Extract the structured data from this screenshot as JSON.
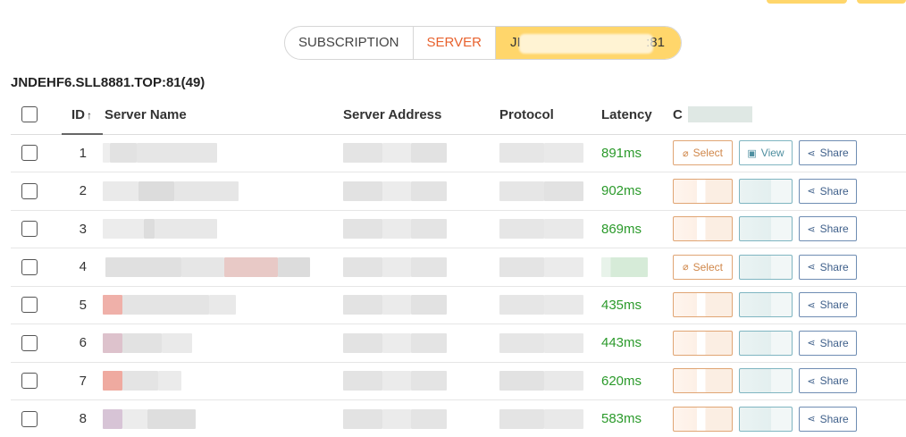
{
  "tabs": [
    {
      "label": "SUBSCRIPTION"
    },
    {
      "label": "SERVER"
    },
    {
      "label_prefix": "JI",
      "label_suffix": ":81"
    }
  ],
  "group_title": "JNDEHF6.SLL8881.TOP:81(49)",
  "columns": {
    "id": "ID",
    "sort_arrow": "↑",
    "name": "Server Name",
    "address": "Server Address",
    "protocol": "Protocol",
    "latency": "Latency",
    "ops_prefix": "C"
  },
  "buttons": {
    "select": "Select",
    "view": "View",
    "share": "Share"
  },
  "icons": {
    "select": "link-icon",
    "view": "qr-icon",
    "share": "share-icon"
  },
  "colors": {
    "accent_yellow": "#ffd66b",
    "server_tab": "#e8622e",
    "latency_green": "#2b9a2b"
  },
  "rows": [
    {
      "id": "1",
      "latency": "891ms",
      "name_blocks": [
        "#eeeeee",
        "#e2e2e2",
        "#e6e6e6"
      ],
      "addr_blocks": [
        "#e4e4e4",
        "#ececec",
        "#e2e2e2"
      ],
      "proto_blocks": [
        "#e6e6e6",
        "#e9e9e9"
      ],
      "select_masked": false,
      "view_masked": false,
      "latency_masked": false
    },
    {
      "id": "2",
      "latency": "902ms",
      "name_blocks": [
        "#eaeaea",
        "#dcdcdc",
        "#e6e6e6"
      ],
      "addr_blocks": [
        "#e2e2e2",
        "#ececec",
        "#e3e3e3"
      ],
      "proto_blocks": [
        "#e6e6e6",
        "#e2e2e2"
      ],
      "select_masked": true,
      "view_masked": true,
      "latency_masked": false
    },
    {
      "id": "3",
      "latency": "869ms",
      "name_blocks": [
        "#ececec",
        "#dddddd",
        "#e8e8e8"
      ],
      "addr_blocks": [
        "#e3e3e3",
        "#ebebeb",
        "#e4e4e4"
      ],
      "proto_blocks": [
        "#e6e6e6",
        "#e9e9e9"
      ],
      "select_masked": true,
      "view_masked": true,
      "latency_masked": false
    },
    {
      "id": "4",
      "latency": "",
      "name_blocks": [
        "#e0e0e0",
        "#e6e6e6",
        "#e8c9c6",
        "#dcdcdc"
      ],
      "addr_blocks": [
        "#e3e3e3",
        "#ebebeb",
        "#e4e4e4"
      ],
      "proto_blocks": [
        "#e4e4e4",
        "#ebebeb"
      ],
      "select_masked": false,
      "view_masked": true,
      "latency_masked": true
    },
    {
      "id": "5",
      "latency": "435ms",
      "name_blocks": [
        "#efb0a9",
        "#e4e4e4",
        "#e9e9e9"
      ],
      "addr_blocks": [
        "#e3e3e3",
        "#ebebeb",
        "#e2e2e2"
      ],
      "proto_blocks": [
        "#e6e6e6",
        "#e9e9e9"
      ],
      "select_masked": true,
      "view_masked": true,
      "latency_masked": false
    },
    {
      "id": "6",
      "latency": "443ms",
      "name_blocks": [
        "#ddc2cc",
        "#e2e2e2",
        "#eaeaea"
      ],
      "addr_blocks": [
        "#e3e3e3",
        "#ececec",
        "#e4e4e4"
      ],
      "proto_blocks": [
        "#e6e6e6",
        "#e9e9e9"
      ],
      "select_masked": true,
      "view_masked": true,
      "latency_masked": false
    },
    {
      "id": "7",
      "latency": "620ms",
      "name_blocks": [
        "#efaaa0",
        "#e4e4e4",
        "#ebebeb"
      ],
      "addr_blocks": [
        "#e3e3e3",
        "#ebebeb",
        "#e4e4e4"
      ],
      "proto_blocks": [
        "#e2e2e2",
        "#e9e9e9"
      ],
      "select_masked": true,
      "view_masked": true,
      "latency_masked": false
    },
    {
      "id": "8",
      "latency": "583ms",
      "name_blocks": [
        "#d7c4d6",
        "#ececec",
        "#dedede"
      ],
      "addr_blocks": [
        "#e3e3e3",
        "#ebebeb",
        "#e4e4e4"
      ],
      "proto_blocks": [
        "#e4e4e4",
        "#e9e9e9"
      ],
      "select_masked": true,
      "view_masked": true,
      "latency_masked": false
    }
  ]
}
